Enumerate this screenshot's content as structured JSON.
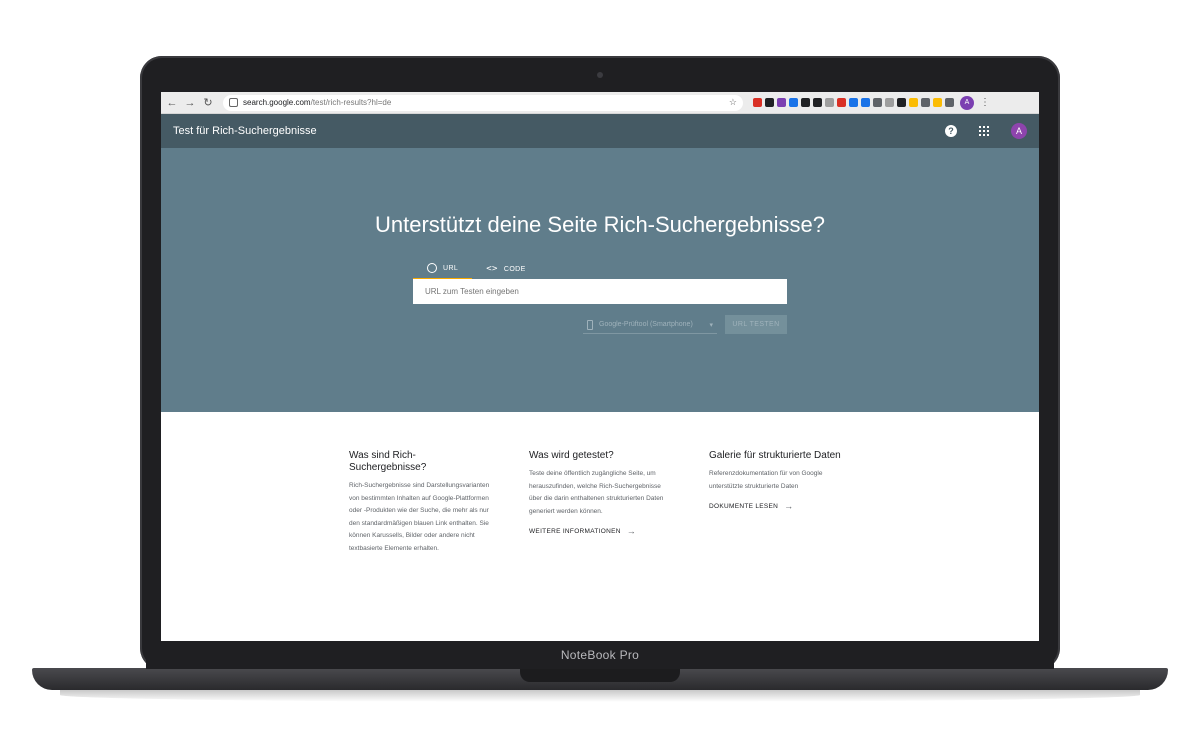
{
  "device_label": "NoteBook Pro",
  "browser": {
    "url_host": "search.google.com",
    "url_path": "/test/rich-results?hl=de",
    "profile_initial": "A",
    "extension_colors": [
      "#d93025",
      "#202124",
      "#7b3fb1",
      "#1a73e8",
      "#202124",
      "#202124",
      "#9e9e9e",
      "#d93025",
      "#1a73e8",
      "#1a73e8",
      "#5f6368",
      "#9e9e9e",
      "#202124",
      "#fbbc04",
      "#5f6368",
      "#fbbc04",
      "#5f6368"
    ]
  },
  "appbar": {
    "title": "Test für Rich-Suchergebnisse",
    "avatar_initial": "A"
  },
  "hero": {
    "headline": "Unterstützt deine Seite Rich-Suchergebnisse?",
    "tab_url": "URL",
    "tab_code": "CODE",
    "url_placeholder": "URL zum Testen eingeben",
    "device_select": "Google-Prüftool (Smartphone)",
    "test_button": "URL TESTEN"
  },
  "info": [
    {
      "title": "Was sind Rich-Suchergebnisse?",
      "body": "Rich-Suchergebnisse sind Darstellungsvarianten von bestimmten Inhalten auf Google-Plattformen oder -Produkten wie der Suche, die mehr als nur den standardmäßigen blauen Link enthalten. Sie können Karussells, Bilder oder andere nicht textbasierte Elemente erhalten.",
      "link": ""
    },
    {
      "title": "Was wird getestet?",
      "body": "Teste deine öffentlich zugängliche Seite, um herauszufinden, welche Rich-Suchergebnisse über die darin enthaltenen strukturierten Daten generiert werden können.",
      "link": "WEITERE INFORMATIONEN"
    },
    {
      "title": "Galerie für strukturierte Daten",
      "body": "Referenzdokumentation für von Google unterstützte strukturierte Daten",
      "link": "DOKUMENTE LESEN"
    }
  ]
}
